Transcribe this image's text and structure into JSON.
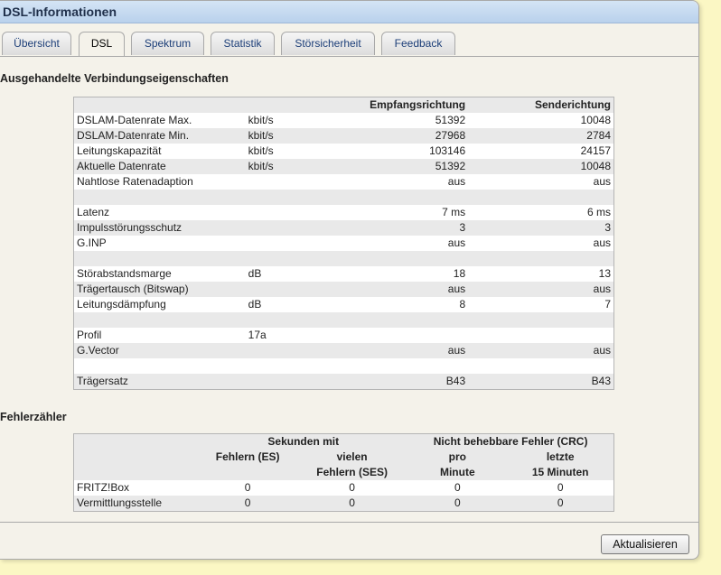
{
  "window": {
    "title": "DSL-Informationen"
  },
  "tabs": [
    "Übersicht",
    "DSL",
    "Spektrum",
    "Statistik",
    "Störsicherheit",
    "Feedback"
  ],
  "active_tab": "DSL",
  "section1": {
    "title": "Ausgehandelte Verbindungseigenschaften",
    "col_down": "Empfangsrichtung",
    "col_up": "Senderichtung",
    "rows": [
      {
        "label": "DSLAM-Datenrate Max.",
        "unit": "kbit/s",
        "down": "51392",
        "up": "10048"
      },
      {
        "label": "DSLAM-Datenrate Min.",
        "unit": "kbit/s",
        "down": "27968",
        "up": "2784"
      },
      {
        "label": "Leitungskapazität",
        "unit": "kbit/s",
        "down": "103146",
        "up": "24157"
      },
      {
        "label": "Aktuelle Datenrate",
        "unit": "kbit/s",
        "down": "51392",
        "up": "10048"
      },
      {
        "label": "Nahtlose Ratenadaption",
        "unit": "",
        "down": "aus",
        "up": "aus"
      },
      {
        "label": "",
        "unit": "",
        "down": "",
        "up": ""
      },
      {
        "label": "Latenz",
        "unit": "",
        "down": "7 ms",
        "up": "6 ms"
      },
      {
        "label": "Impulsstörungsschutz",
        "unit": "",
        "down": "3",
        "up": "3"
      },
      {
        "label": "G.INP",
        "unit": "",
        "down": "aus",
        "up": "aus"
      },
      {
        "label": "",
        "unit": "",
        "down": "",
        "up": ""
      },
      {
        "label": "Störabstandsmarge",
        "unit": "dB",
        "down": "18",
        "up": "13"
      },
      {
        "label": "Trägertausch (Bitswap)",
        "unit": "",
        "down": "aus",
        "up": "aus"
      },
      {
        "label": "Leitungsdämpfung",
        "unit": "dB",
        "down": "8",
        "up": "7"
      },
      {
        "label": "",
        "unit": "",
        "down": "",
        "up": ""
      },
      {
        "label": "Profil",
        "unit": "17a",
        "down": "",
        "up": ""
      },
      {
        "label": "G.Vector",
        "unit": "",
        "down": "aus",
        "up": "aus"
      },
      {
        "label": "",
        "unit": "",
        "down": "",
        "up": ""
      },
      {
        "label": "Trägersatz",
        "unit": "",
        "down": "B43",
        "up": "B43"
      }
    ]
  },
  "section2": {
    "title": "Fehlerzähler",
    "group1": "Sekunden mit",
    "group2": "Nicht behebbare Fehler (CRC)",
    "sub1": "Fehlern (ES)",
    "sub2a": "vielen",
    "sub2b": "Fehlern (SES)",
    "sub3a": "pro",
    "sub3b": "Minute",
    "sub4a": "letzte",
    "sub4b": "15 Minuten",
    "rows": [
      {
        "label": "FRITZ!Box",
        "es": "0",
        "ses": "0",
        "crc_min": "0",
        "crc_15": "0"
      },
      {
        "label": "Vermittlungsstelle",
        "es": "0",
        "ses": "0",
        "crc_min": "0",
        "crc_15": "0"
      }
    ]
  },
  "button": {
    "refresh": "Aktualisieren"
  },
  "colors": {
    "background": "#fbf7c4",
    "titlebar": "#c8dbf0",
    "tab_text": "#1c3e78"
  }
}
